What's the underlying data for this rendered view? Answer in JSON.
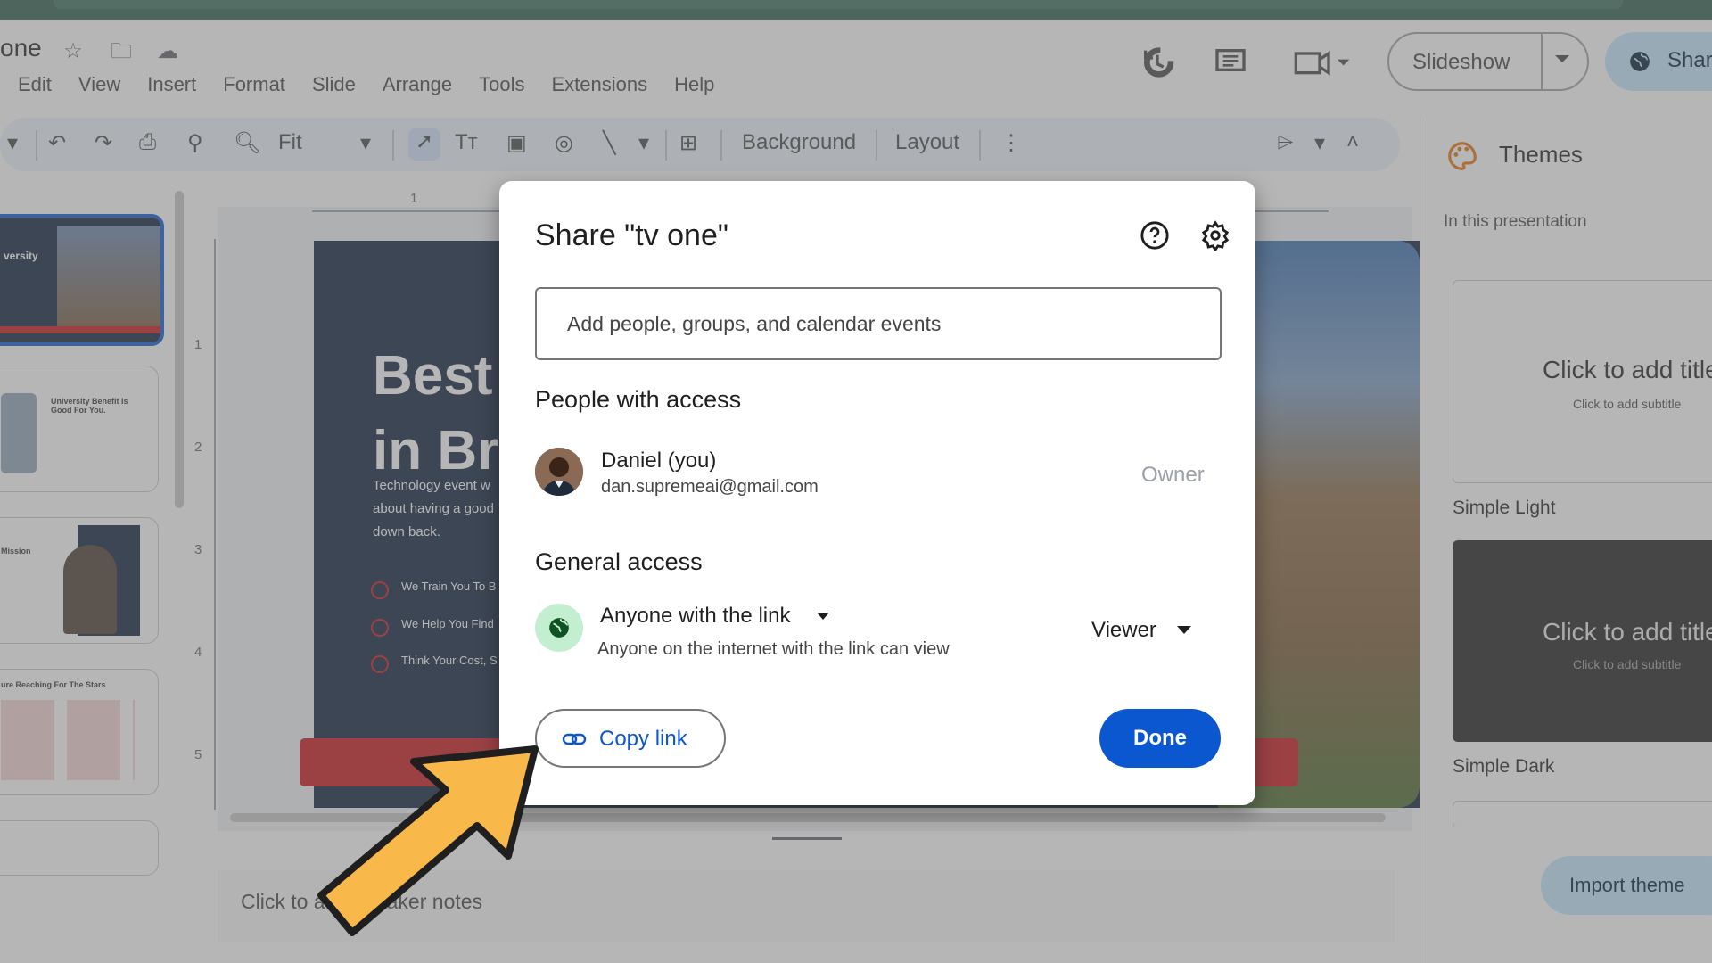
{
  "doc": {
    "title_fragment": "one"
  },
  "menu": [
    "Edit",
    "View",
    "Insert",
    "Format",
    "Slide",
    "Arrange",
    "Tools",
    "Extensions",
    "Help"
  ],
  "header": {
    "slideshow_label": "Slideshow",
    "share_label": "Shar"
  },
  "toolbar": {
    "zoom": "Fit",
    "background": "Background",
    "layout": "Layout"
  },
  "themes": {
    "title": "Themes",
    "section": "In this presentation",
    "items": [
      {
        "name": "Simple Light",
        "title_text": "Click to add title",
        "subtitle_text": "Click to add subtitle"
      },
      {
        "name": "Simple Dark",
        "title_text": "Click to add title",
        "subtitle_text": "Click to add subtitle"
      }
    ],
    "import_label": "Import theme"
  },
  "filmstrip": {
    "thumb1": "versity",
    "thumb2": "University Benefit Is Good For You.",
    "thumb3": "Mission",
    "thumb4": "ure Reaching For The Stars"
  },
  "slide": {
    "line1": "Best",
    "line2": "in Bra",
    "body": [
      "Technology event w",
      "about having a good",
      "down back."
    ],
    "bullets": [
      "We Train You To B",
      "We Help You Find",
      "Think Your Cost, S"
    ]
  },
  "ruler": {
    "h1": "1",
    "v": [
      "1",
      "2",
      "3",
      "4",
      "5"
    ]
  },
  "notes": {
    "placeholder": "Click to add speaker notes"
  },
  "dialog": {
    "title": "Share \"tv one\"",
    "input_placeholder": "Add people, groups, and calendar events",
    "people_heading": "People with access",
    "person": {
      "name": "Daniel (you)",
      "email": "dan.supremeai@gmail.com",
      "role": "Owner"
    },
    "general_heading": "General access",
    "access": {
      "label": "Anyone with the link",
      "description": "Anyone on the internet with the link can view",
      "role": "Viewer"
    },
    "copy_link_label": "Copy link",
    "done_label": "Done"
  },
  "colors": {
    "primary": "#0b57d0",
    "share_bg": "#c2e7ff",
    "slide_navy": "#0b1e3a",
    "accent_red": "#c8151b",
    "arrow": "#f9b94a"
  }
}
